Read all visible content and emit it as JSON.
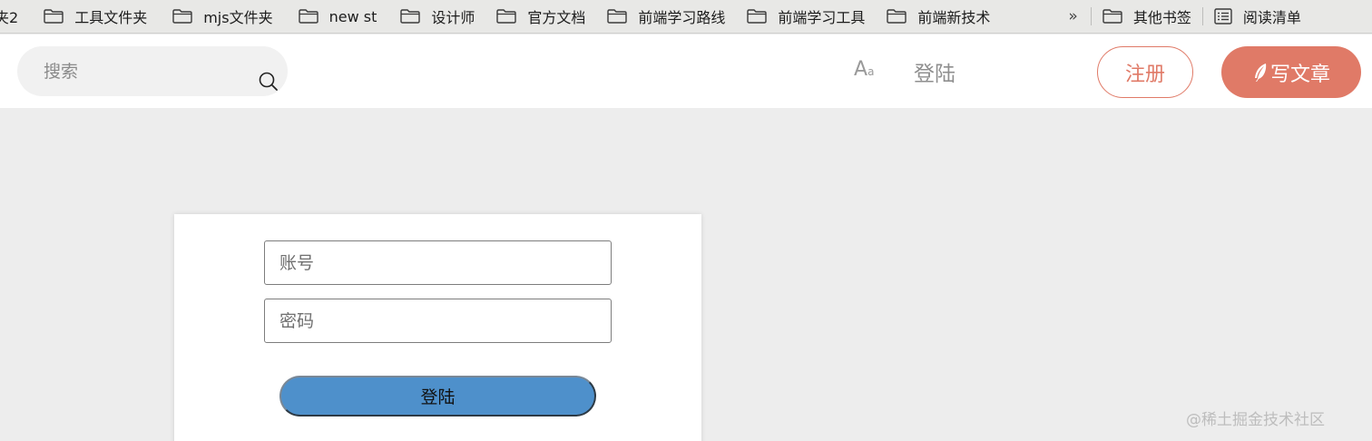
{
  "bookmarks": {
    "items": [
      {
        "label": "夹2",
        "cut": true
      },
      {
        "label": "工具文件夹"
      },
      {
        "label": "mjs文件夹"
      },
      {
        "label": "new st"
      },
      {
        "label": "设计师"
      },
      {
        "label": "官方文档"
      },
      {
        "label": "前端学习路线"
      },
      {
        "label": "前端学习工具"
      },
      {
        "label": "前端新技术"
      }
    ],
    "more": "»",
    "other": "其他书签",
    "reading_list": "阅读清单"
  },
  "header": {
    "search_placeholder": "搜索",
    "font_toggle": "A",
    "font_toggle_small": "a",
    "login": "登陆",
    "register": "注册",
    "write": "写文章",
    "accent": "#e07a67"
  },
  "login_form": {
    "account_placeholder": "账号",
    "password_placeholder": "密码",
    "submit": "登陆",
    "button_color": "#4e90cb"
  },
  "watermark": "@稀土掘金技术社区"
}
